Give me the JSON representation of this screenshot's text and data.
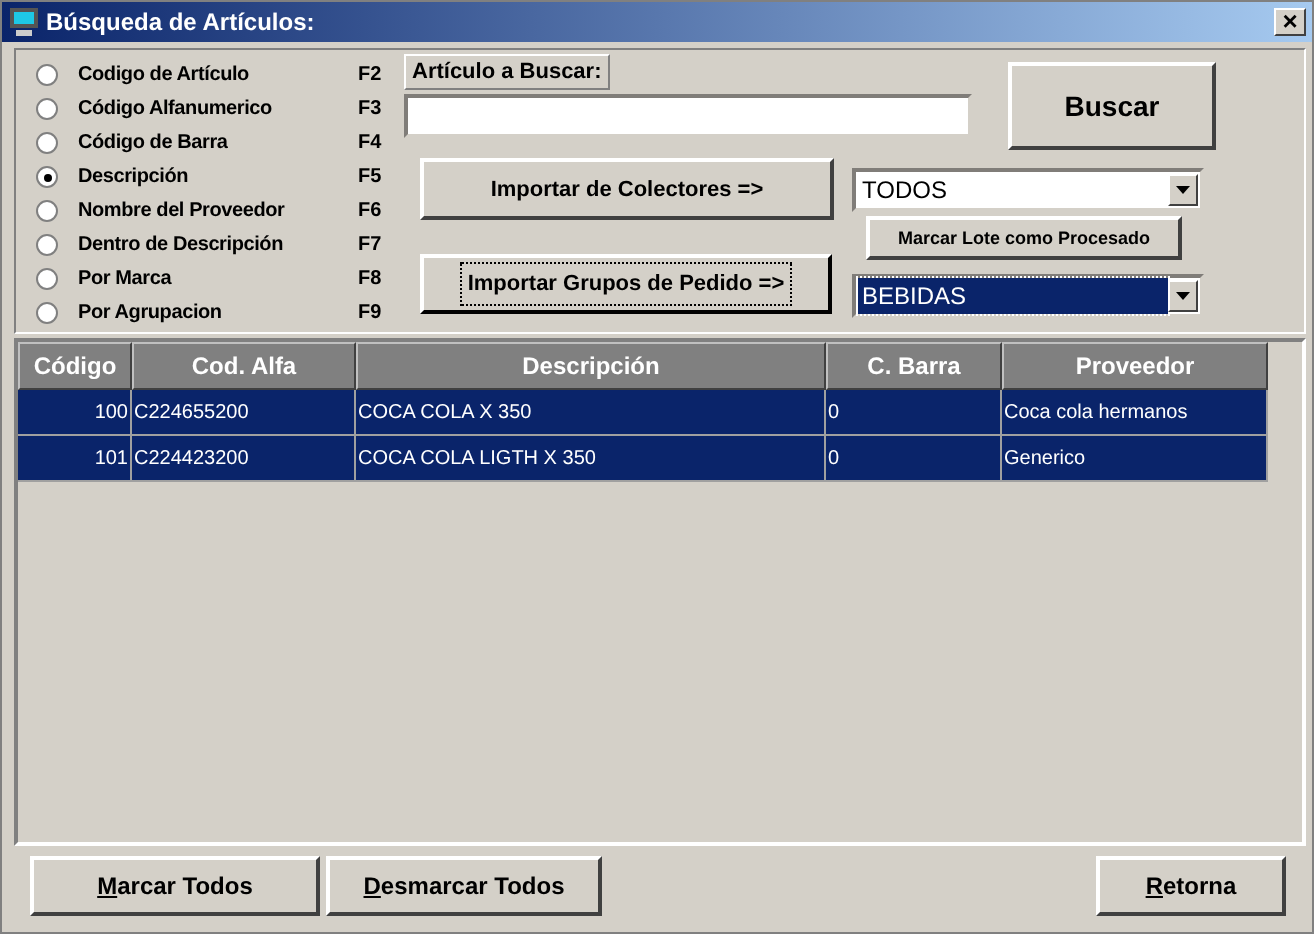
{
  "window": {
    "title": "Búsqueda de Artículos:",
    "close": "×"
  },
  "search_options": [
    {
      "label": "Codigo de Artículo",
      "key": "F2",
      "selected": false
    },
    {
      "label": "Código Alfanumerico",
      "key": "F3",
      "selected": false
    },
    {
      "label": "Código de Barra",
      "key": "F4",
      "selected": false
    },
    {
      "label": "Descripción",
      "key": "F5",
      "selected": true
    },
    {
      "label": "Nombre del Proveedor",
      "key": "F6",
      "selected": false
    },
    {
      "label": "Dentro de Descripción",
      "key": "F7",
      "selected": false
    },
    {
      "label": "Por Marca",
      "key": "F8",
      "selected": false
    },
    {
      "label": "Por Agrupacion",
      "key": "F9",
      "selected": false
    }
  ],
  "search_label": "Artículo a Buscar:",
  "search_button": "Buscar",
  "import_collectors_button": "Importar de Colectores =>",
  "import_groups_button": {
    "label": "Importar Grupos de Pedido =>",
    "focused": true
  },
  "collector_combo": {
    "value": "TODOS",
    "highlighted": false
  },
  "mark_batch_button": "Marcar Lote como Procesado",
  "group_combo": {
    "value": "BEBIDAS",
    "highlighted": true
  },
  "table": {
    "columns": [
      "Código",
      "Cod. Alfa",
      "Descripción",
      "C. Barra",
      "Proveedor"
    ],
    "rows": [
      {
        "cells": [
          "100",
          "C224655200",
          "COCA COLA X 350",
          "0",
          "Coca cola hermanos"
        ],
        "selected": true
      },
      {
        "cells": [
          "101",
          "C224423200",
          "COCA COLA LIGTH X 350",
          "0",
          "Generico"
        ],
        "selected": true
      }
    ]
  },
  "bottom_buttons": [
    {
      "label": "Marcar Todos",
      "mnemonic": true
    },
    {
      "label": "Desmarcar Todos",
      "mnemonic": true
    },
    {
      "label": "Retorna",
      "mnemonic": true
    }
  ]
}
